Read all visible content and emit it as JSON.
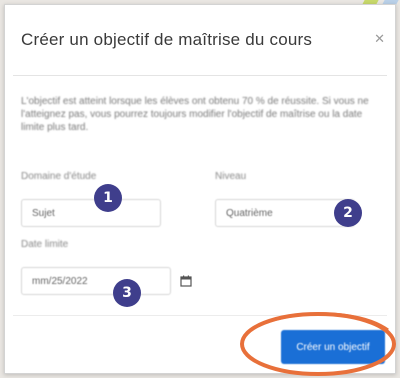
{
  "dialog": {
    "title": "Créer un objectif de maîtrise du cours",
    "close_icon": "close-icon",
    "description": "L'objectif est atteint lorsque les élèves ont obtenu 70 % de réussite. Si vous ne l'atteignez pas, vous pourrez toujours modifier l'objectif de maîtrise ou la date limite plus tard.",
    "fields": {
      "domain_label": "Domaine d'étude",
      "domain_value": "Sujet",
      "level_label": "Niveau",
      "level_value": "Quatrième",
      "date_label": "Date limite",
      "date_value": "mm/25/2022"
    },
    "create_button": "Créer un objectif"
  },
  "annotations": {
    "badge_1": "1",
    "badge_2": "2",
    "badge_3": "3"
  },
  "colors": {
    "badge": "#3f3e8c",
    "button": "#1a6fd6",
    "highlight": "#e8703a"
  }
}
